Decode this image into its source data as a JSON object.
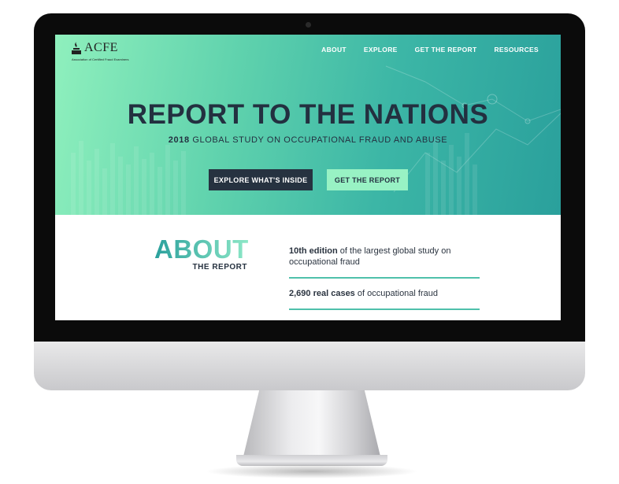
{
  "brand": {
    "name": "ACFE",
    "tagline": "Association of Certified Fraud Examiners"
  },
  "nav": {
    "items": [
      {
        "label": "ABOUT"
      },
      {
        "label": "EXPLORE"
      },
      {
        "label": "GET THE REPORT"
      },
      {
        "label": "RESOURCES"
      }
    ]
  },
  "hero": {
    "title": "REPORT TO THE NATIONS",
    "subtitle_year": "2018",
    "subtitle_rest": "GLOBAL STUDY ON OCCUPATIONAL FRAUD AND ABUSE",
    "buttons": {
      "explore": "EXPLORE WHAT'S INSIDE",
      "get_report": "GET THE REPORT"
    }
  },
  "about": {
    "heading": "ABOUT",
    "subheading": "THE REPORT",
    "stats": [
      {
        "highlight": "10th edition",
        "rest": " of the largest global study on occupational fraud"
      },
      {
        "highlight": "2,690 real cases",
        "rest": " of occupational fraud"
      }
    ]
  },
  "colors": {
    "dark": "#263240",
    "accent_light": "#98f2c4",
    "accent_teal": "#2aa09c"
  }
}
